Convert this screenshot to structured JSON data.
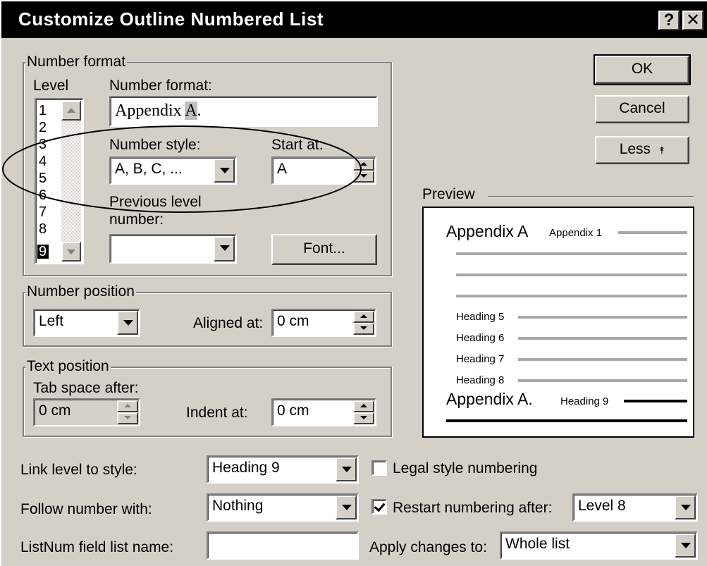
{
  "window": {
    "title": "Customize Outline Numbered List",
    "help_glyph": "?",
    "close_glyph": "✕"
  },
  "number_format_group": {
    "legend": "Number format",
    "level_label": "Level",
    "levels": [
      "1",
      "2",
      "3",
      "4",
      "5",
      "6",
      "7",
      "8",
      "9"
    ],
    "selected_level": "9",
    "number_format_label": "Number format:",
    "number_format_value_prefix": "Appendix ",
    "number_format_value_highlight": "A",
    "number_format_value_suffix": ".",
    "number_style_label": "Number style:",
    "number_style_value": "A, B, C, ...",
    "start_at_label": "Start at:",
    "start_at_value": "A",
    "previous_level_label_1": "Previous level",
    "previous_level_label_2": "number:",
    "previous_level_value": "",
    "font_button": "Font..."
  },
  "buttons": {
    "ok": "OK",
    "cancel": "Cancel",
    "less": "Less",
    "less_glyph": "⯭"
  },
  "number_position_group": {
    "legend": "Number position",
    "alignment_value": "Left",
    "aligned_at_label": "Aligned at:",
    "aligned_at_value": "0 cm"
  },
  "text_position_group": {
    "legend": "Text position",
    "tab_space_label": "Tab space after:",
    "tab_space_value": "0 cm",
    "indent_at_label": "Indent at:",
    "indent_at_value": "0 cm"
  },
  "preview": {
    "label": "Preview",
    "line1_big": "Appendix A",
    "line1_small": "Appendix 1",
    "heading5": "Heading 5",
    "heading6": "Heading 6",
    "heading7": "Heading 7",
    "heading8": "Heading 8",
    "line9_big": "Appendix A.",
    "line9_small": "Heading 9"
  },
  "bottom": {
    "link_level_label": "Link level to style:",
    "link_level_value": "Heading 9",
    "follow_number_label": "Follow number with:",
    "follow_number_value": "Nothing",
    "listnum_label": "ListNum field list name:",
    "listnum_value": "",
    "legal_label": "Legal style numbering",
    "legal_checked": false,
    "restart_label": "Restart numbering after:",
    "restart_checked": true,
    "restart_value": "Level 8",
    "apply_label": "Apply changes to:",
    "apply_value": "Whole list"
  }
}
